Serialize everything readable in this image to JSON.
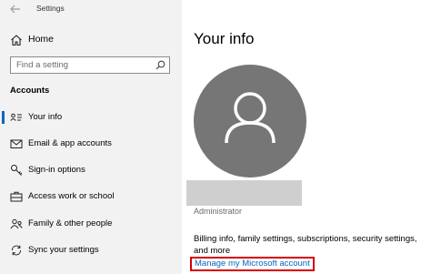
{
  "window": {
    "title": "Settings"
  },
  "sidebar": {
    "home_label": "Home",
    "search": {
      "placeholder": "Find a setting",
      "value": ""
    },
    "section_heading": "Accounts",
    "items": [
      {
        "label": "Your info",
        "icon": "person-card-icon",
        "selected": true
      },
      {
        "label": "Email & app accounts",
        "icon": "mail-icon",
        "selected": false
      },
      {
        "label": "Sign-in options",
        "icon": "key-icon",
        "selected": false
      },
      {
        "label": "Access work or school",
        "icon": "briefcase-icon",
        "selected": false
      },
      {
        "label": "Family & other people",
        "icon": "people-icon",
        "selected": false
      },
      {
        "label": "Sync your settings",
        "icon": "sync-icon",
        "selected": false
      }
    ]
  },
  "main": {
    "title": "Your info",
    "account_type": "Administrator",
    "billing_text": "Billing info, family settings, subscriptions, security settings, and more",
    "manage_link": "Manage my Microsoft account"
  },
  "colors": {
    "accent": "#0067c0",
    "sidebar_bg": "#f2f2f2",
    "avatar_bg": "#767676",
    "highlight_border": "#d60000",
    "redacted_block": "#cfcfcf"
  }
}
